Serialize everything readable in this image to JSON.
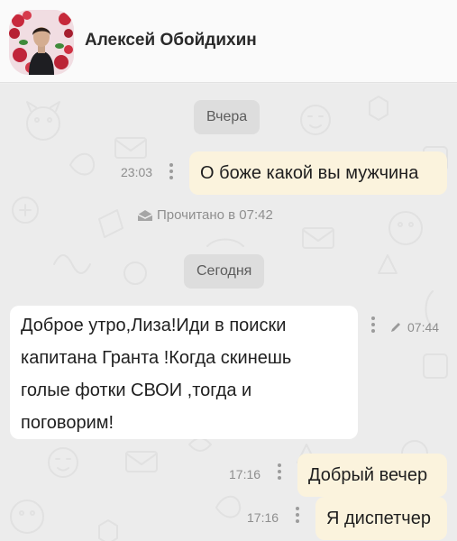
{
  "header": {
    "contact_name": "Алексей Обойдихин",
    "avatar_icon": "user-avatar-photo"
  },
  "chat": {
    "date_yesterday": "Вчера",
    "date_today": "Сегодня",
    "read_status": "Прочитано в 07:42",
    "messages": [
      {
        "direction": "outgoing",
        "text": "О боже какой вы мужчина",
        "time": "23:03"
      },
      {
        "direction": "incoming",
        "lines": [
          "Доброе утро,Лиза!Иди в поиски",
          "капитана Гранта !Когда скинешь",
          "голые фотки СВОИ ,тогда и",
          "поговорим!"
        ],
        "time": "07:44",
        "edited": true
      },
      {
        "direction": "outgoing",
        "text": "Добрый вечер",
        "time": "17:16"
      },
      {
        "direction": "outgoing",
        "text": "Я диспетчер",
        "time": "17:16"
      }
    ]
  },
  "colors": {
    "outgoing_bubble": "#fbf3dd",
    "incoming_bubble": "#ffffff",
    "chat_background": "#ececec"
  }
}
